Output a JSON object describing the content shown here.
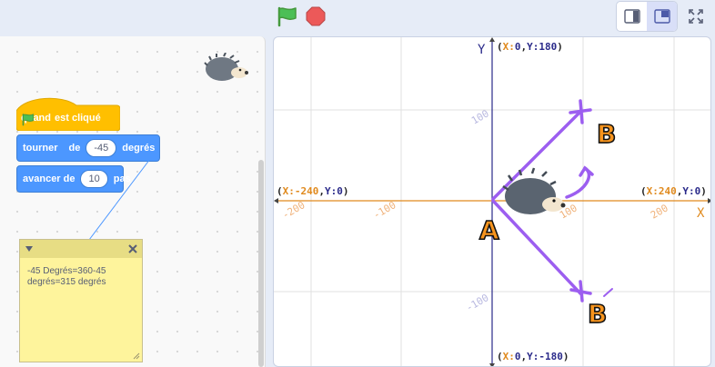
{
  "toolbar": {
    "flag_icon": "green-flag-icon",
    "stop_icon": "stop-icon",
    "colors": {
      "flag": "#4cbf56",
      "stop": "#ec5959",
      "active_mode": "#d9dff8"
    }
  },
  "script": {
    "hat": {
      "label_before": "quand",
      "label_after": "est cliqué",
      "color": "#ffbf00"
    },
    "turn": {
      "label": "tourner",
      "label_de": "de",
      "value": "-45",
      "label_unit": "degrés",
      "color": "#4c97ff"
    },
    "move": {
      "label": "avancer de",
      "value": "10",
      "label_unit": "pas"
    }
  },
  "comment": {
    "line1": "-45 Degrés=360-45",
    "line2": "degrés=315 degrés",
    "color": "#fef49c"
  },
  "stage": {
    "axis_x_name": "X",
    "axis_y_name": "Y",
    "coord_top": {
      "prefix": "(",
      "k1": "X:",
      "v1": "0",
      "sep": ",",
      "k2": "Y:",
      "v2": "180",
      "suffix": ")"
    },
    "coord_bottom": {
      "prefix": "(",
      "k1": "X:",
      "v1": "0",
      "sep": ",",
      "k2": "Y:",
      "v2": "-180",
      "suffix": ")"
    },
    "coord_left": {
      "prefix": "(",
      "k1": "X:",
      "v1": "-240",
      "sep": ",",
      "k2": "Y:",
      "v2": "0",
      "suffix": ")"
    },
    "coord_right": {
      "prefix": "(",
      "k1": "X:",
      "v1": "240",
      "sep": ",",
      "k2": "Y:",
      "v2": "0",
      "suffix": ")"
    },
    "ticks_x": [
      "-200",
      "-100",
      "100",
      "200"
    ],
    "ticks_y": [
      "100",
      "-100"
    ],
    "annotations": {
      "origin": "A",
      "point_up": "B",
      "point_down": "B"
    },
    "colors": {
      "x_axis": "#e08a1e",
      "y_axis": "#2a2a8a",
      "ink": "#9c5ef0",
      "letter": "#f7941d"
    }
  }
}
